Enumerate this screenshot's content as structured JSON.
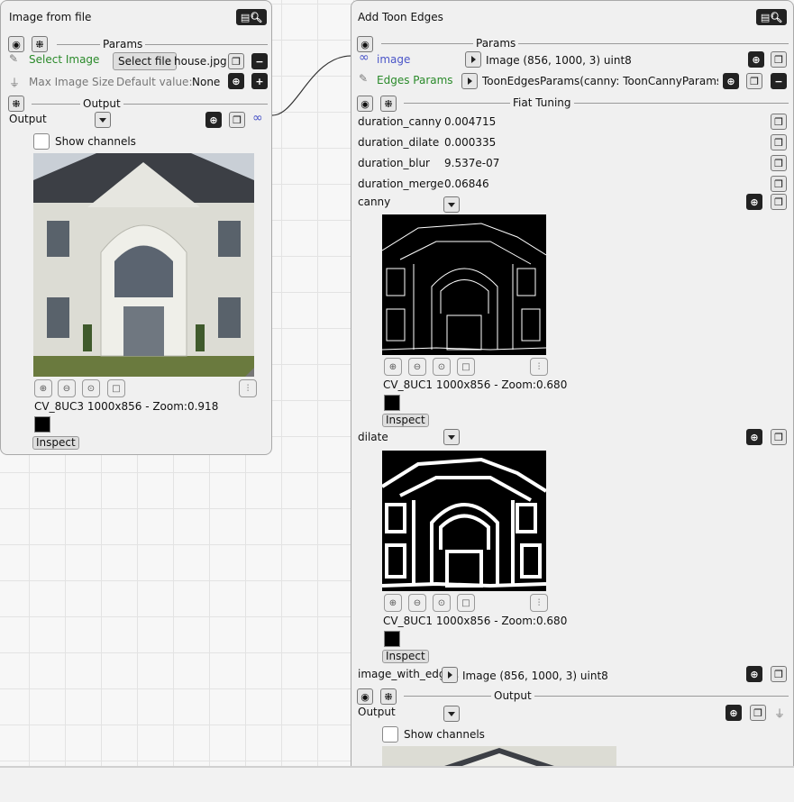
{
  "node1": {
    "title": "Image from file",
    "params_label": "Params",
    "select_image_label": "Select Image",
    "select_file_button": "Select file",
    "file_value": "house.jpg",
    "max_image_size_label": "Max Image Size",
    "default_value_label": "Default value:",
    "default_value": "None",
    "output_section_label": "Output",
    "output_label": "Output",
    "show_channels": "Show channels",
    "image_info": "CV_8UC3 1000x856 - Zoom:0.918",
    "inspect": "Inspect"
  },
  "node2": {
    "title": "Add Toon Edges",
    "params_label": "Params",
    "image_input_label": "image",
    "image_input_value": "Image (856, 1000, 3) uint8",
    "edges_params_label": "Edges Params",
    "edges_params_value": "ToonEdgesParams(canny: ToonCannyParams(t...",
    "fiat_tuning_label": "Fiat Tuning",
    "tuning": [
      {
        "name": "duration_canny",
        "value": "0.004715"
      },
      {
        "name": "duration_dilate",
        "value": "0.000335"
      },
      {
        "name": "duration_blur",
        "value": "9.537e-07"
      },
      {
        "name": "duration_merge",
        "value": "0.06846"
      }
    ],
    "canny_label": "canny",
    "canny_info": "CV_8UC1 1000x856 - Zoom:0.680",
    "dilate_label": "dilate",
    "dilate_info": "CV_8UC1 1000x856 - Zoom:0.680",
    "inspect": "Inspect",
    "image_with_edges_label": "image_with_edge..",
    "image_with_edges_value": "Image (856, 1000, 3) uint8",
    "output_section_label": "Output",
    "output_label": "Output",
    "show_channels": "Show channels"
  },
  "colors": {
    "accent_green": "#2a8a2a",
    "link_blue": "#4a55c8",
    "node_bg": "#f0f0f0",
    "icon_dark": "#222222"
  },
  "icons": [
    "eye-icon",
    "collapse-icon",
    "pencil-icon",
    "unplug-icon",
    "copy-icon",
    "minus-icon",
    "plus-icon",
    "magnify-icon",
    "link-icon",
    "play-arrow-icon",
    "dropdown-arrow-icon",
    "zoom-in-icon",
    "zoom-out-icon",
    "zoom-reset-icon",
    "fit-icon",
    "levels-icon"
  ]
}
